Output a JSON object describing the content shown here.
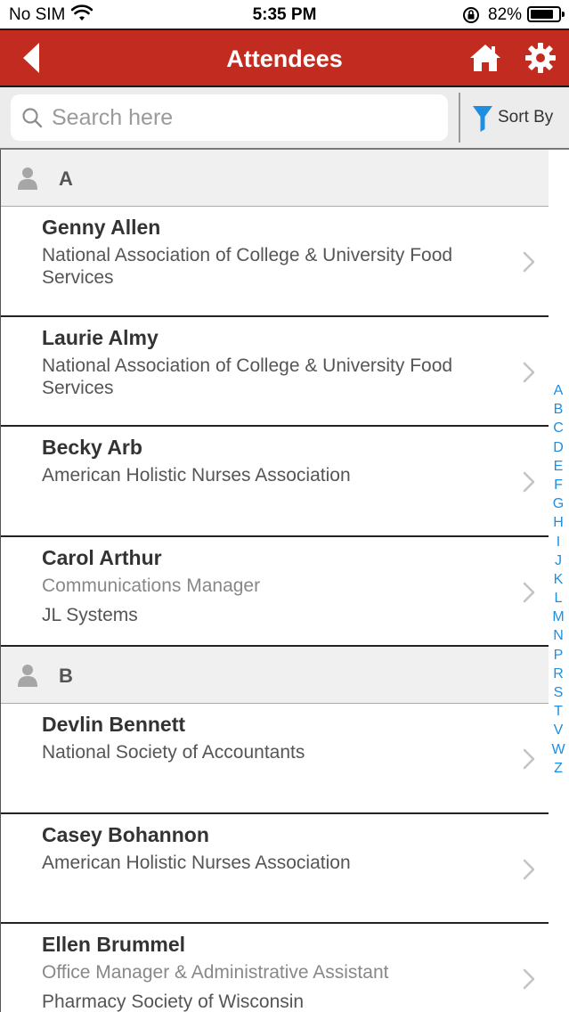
{
  "status_bar": {
    "carrier": "No SIM",
    "time": "5:35 PM",
    "battery_pct": "82%",
    "battery_level": 0.82
  },
  "nav": {
    "title": "Attendees",
    "bar_color": "#c22b1f",
    "back_icon": "back-arrow-icon",
    "home_icon": "home-icon",
    "settings_icon": "gear-icon"
  },
  "search": {
    "placeholder": "Search here",
    "value": ""
  },
  "sort": {
    "label": "Sort By",
    "icon": "funnel-icon",
    "icon_color": "#1e8fe0"
  },
  "sections": [
    {
      "letter": "A",
      "attendees": [
        {
          "name": "Genny Allen",
          "line1": "National Association of College & University Food Services",
          "line2": ""
        },
        {
          "name": "Laurie Almy",
          "line1": "National Association of College & University Food Services",
          "line2": ""
        },
        {
          "name": "Becky Arb",
          "line1": "American Holistic Nurses Association",
          "line2": ""
        },
        {
          "name": "Carol Arthur",
          "line1": "Communications Manager",
          "line2": "JL Systems"
        }
      ]
    },
    {
      "letter": "B",
      "attendees": [
        {
          "name": "Devlin Bennett",
          "line1": "National Society of Accountants",
          "line2": ""
        },
        {
          "name": "Casey Bohannon",
          "line1": "American Holistic Nurses Association",
          "line2": ""
        },
        {
          "name": "Ellen Brummel",
          "line1": "Office Manager & Administrative Assistant",
          "line2": "Pharmacy Society of Wisconsin"
        }
      ]
    }
  ],
  "alpha_index": [
    "A",
    "B",
    "C",
    "D",
    "E",
    "F",
    "G",
    "H",
    "I",
    "J",
    "K",
    "L",
    "M",
    "N",
    "P",
    "R",
    "S",
    "T",
    "V",
    "W",
    "Z"
  ],
  "index_color": "#1e8fe0"
}
